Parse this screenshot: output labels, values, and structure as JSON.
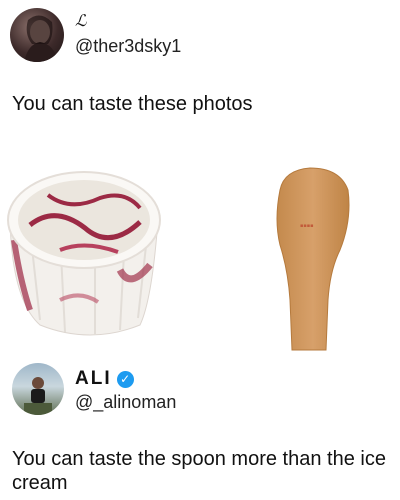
{
  "tweet1": {
    "display_name": "ℒ",
    "handle": "@ther3dsky1",
    "text": "You can taste these photos",
    "images": [
      "ice-cream-cup",
      "wooden-spoon"
    ]
  },
  "tweet2": {
    "display_name": "ALI",
    "verified_icon": "verified-check-icon",
    "handle": "@_alinoman",
    "text": "You can taste the spoon more than the ice cream"
  },
  "colors": {
    "verified": "#1d9bf0",
    "text": "#111111"
  }
}
